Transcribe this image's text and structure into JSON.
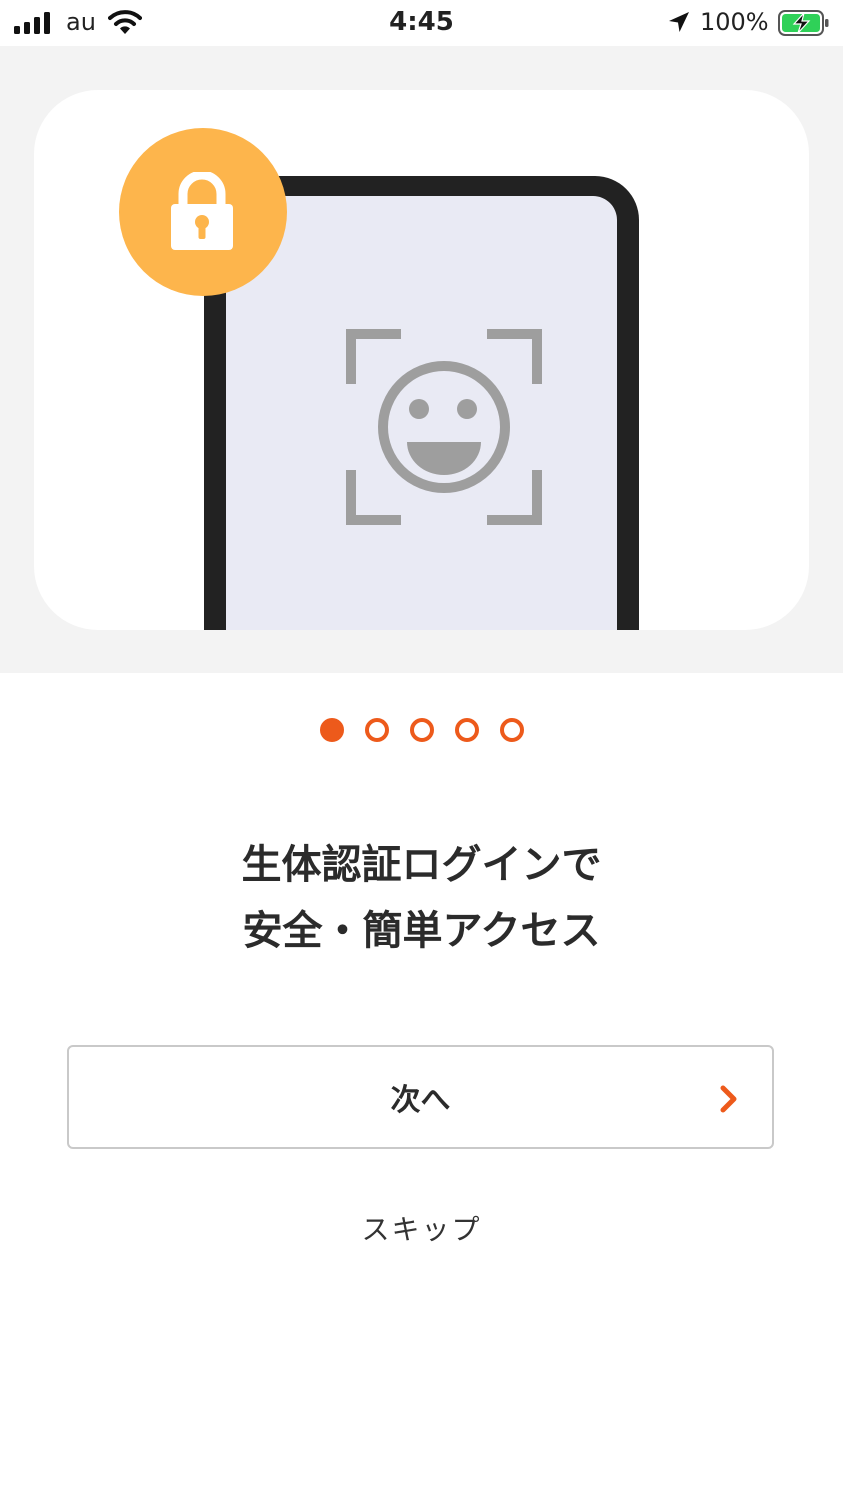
{
  "status_bar": {
    "carrier": "au",
    "time": "4:45",
    "battery_percent": "100%",
    "icons": [
      "signal-icon",
      "wifi-icon",
      "location-arrow-icon",
      "battery-charging-icon"
    ]
  },
  "hero": {
    "illustration": [
      "lock-icon",
      "face-id-scan-icon"
    ]
  },
  "pagination": {
    "total_pages": 5,
    "current_page": 1
  },
  "headline": {
    "line1": "生体認証ログインで",
    "line2": "安全・簡単アクセス"
  },
  "next_button": {
    "label": "次へ",
    "icon": "chevron-right-icon"
  },
  "skip": {
    "label": "スキップ"
  },
  "colors": {
    "accent": "#ed5a1b",
    "lock_badge": "#fdb54c",
    "hero_background": "#f3f3f3",
    "phone_screen": "#e9eaf4",
    "battery_green": "#2fd158"
  }
}
